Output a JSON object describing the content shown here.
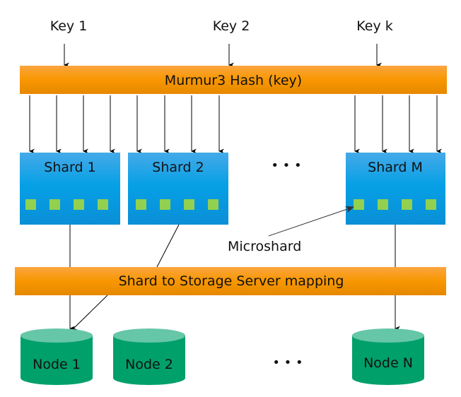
{
  "keys": [
    {
      "label": "Key 1"
    },
    {
      "label": "Key 2"
    },
    {
      "label": "Key k"
    }
  ],
  "hash_bar": {
    "label": "Murmur3 Hash (key)"
  },
  "shards": [
    {
      "label": "Shard 1",
      "microshard_count": 4
    },
    {
      "label": "Shard 2",
      "microshard_count": 4
    },
    {
      "label": "Shard M",
      "microshard_count": 4
    }
  ],
  "shard_ellipsis": "• • •",
  "microshard_callout": "Microshard",
  "mapping_bar": {
    "label": "Shard to Storage Server mapping"
  },
  "nodes": [
    {
      "label": "Node 1"
    },
    {
      "label": "Node 2"
    },
    {
      "label": "Node N"
    }
  ],
  "node_ellipsis": "• • •",
  "colors": {
    "orange_top": "#fba53f",
    "orange_mid": "#f79400",
    "orange_bottom": "#e88a00",
    "shard_top": "#43a9e8",
    "shard_bottom": "#0a8fd6",
    "microshard": "#92d050",
    "node_top": "#66c6a8",
    "node_body": "#00a06a"
  }
}
